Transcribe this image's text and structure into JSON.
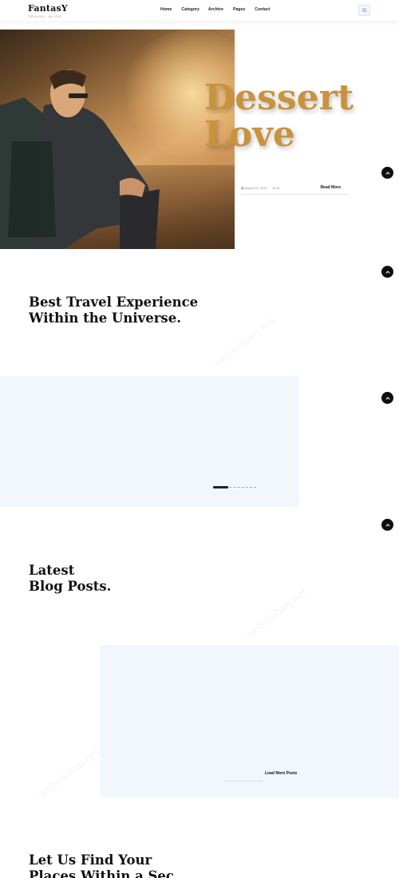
{
  "brand": {
    "name": "FantasY",
    "tagline": "TRAVEL BLOG"
  },
  "nav": {
    "items": [
      "Home",
      "Category",
      "Archive",
      "Pages",
      "Contact"
    ]
  },
  "search": {
    "icon": "search-icon"
  },
  "hero": {
    "title_line1": "Dessert",
    "title_line2": "Love",
    "date": "March 14, 2019",
    "comments": "05",
    "read_more": "Read More"
  },
  "sections": {
    "best_travel_line1": "Best Travel Experience",
    "best_travel_line2": "Within the Universe.",
    "latest_line1": "Latest",
    "latest_line2": "Blog Posts.",
    "find_line1": "Let Us Find Your",
    "find_line2": "Places Within a Sec"
  },
  "load_more": "Load More Posts",
  "watermark": "webmoban.net",
  "colors": {
    "accent": "#c9923f",
    "panel": "#f1f7fd",
    "dark": "#0d0d0d"
  }
}
